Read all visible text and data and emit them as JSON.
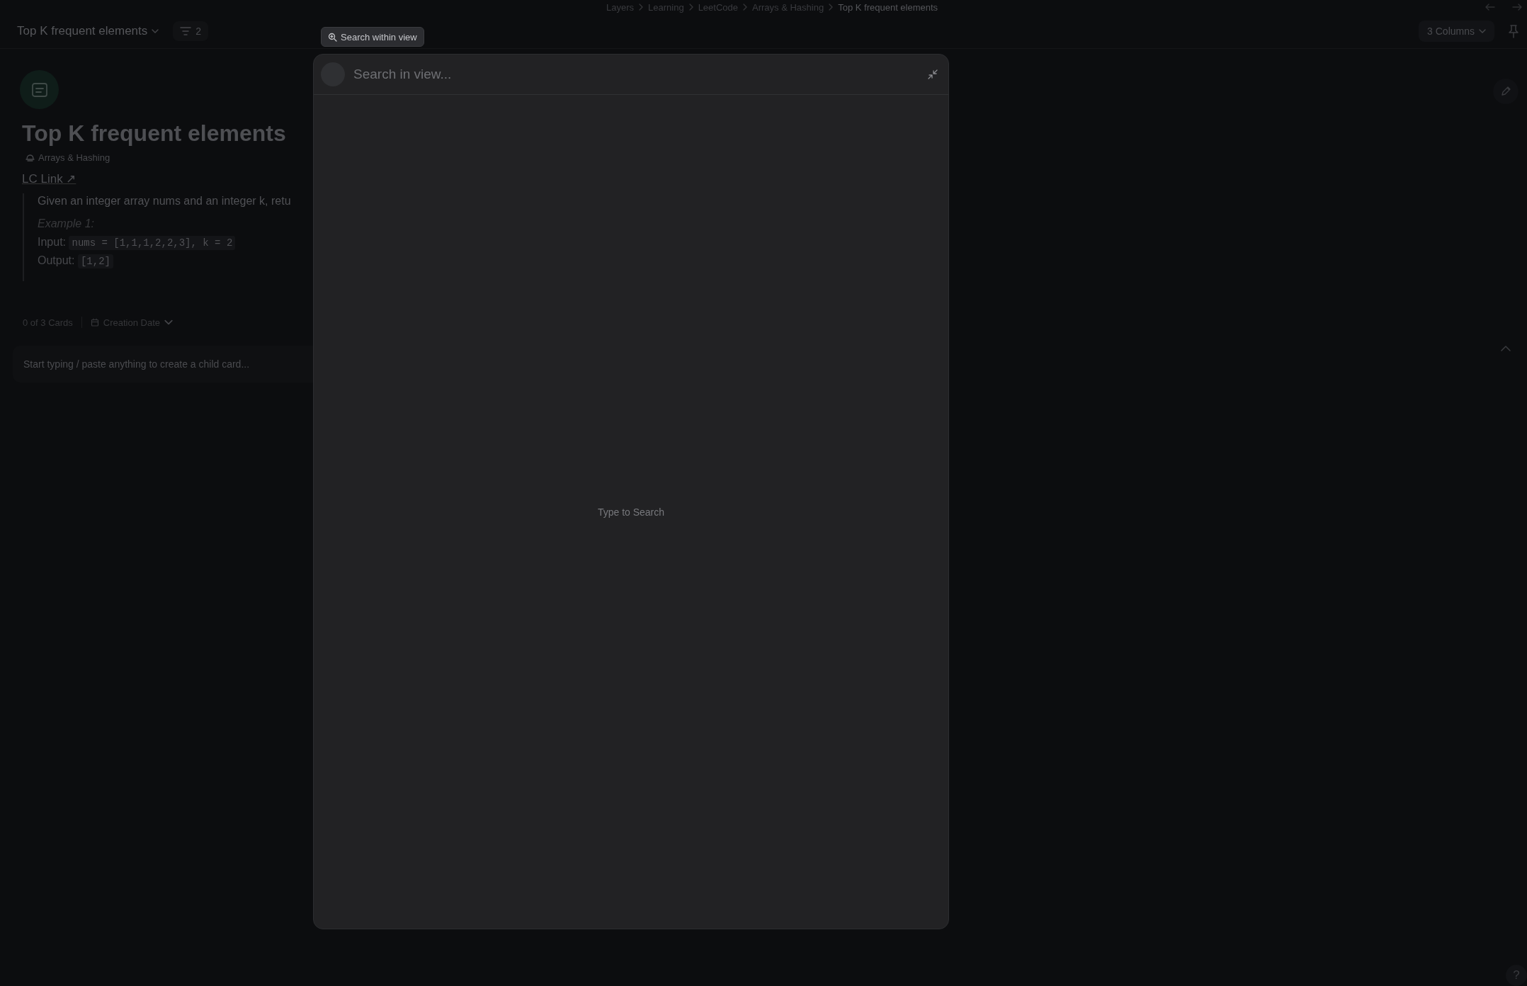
{
  "breadcrumb": [
    {
      "label": "Layers",
      "selected": false
    },
    {
      "label": "Learning",
      "selected": false
    },
    {
      "label": "LeetCode",
      "selected": false
    },
    {
      "label": "Arrays & Hashing",
      "selected": false
    },
    {
      "label": "Top K frequent elements",
      "selected": true
    }
  ],
  "toolbar": {
    "title": "Top K frequent elements",
    "filter_count": "2",
    "columns_button": "3 Columns"
  },
  "card": {
    "title": "Top K frequent elements",
    "tag": "Arrays & Hashing",
    "link": "LC Link ↗",
    "intro": "Given an integer array nums and an integer k, retu",
    "example_heading": "Example 1:",
    "example_lines": [
      {
        "label": "Input:",
        "code": "nums = [1,1,1,2,2,3], k = 2"
      },
      {
        "label": "Output:",
        "code": "[1,2]"
      }
    ]
  },
  "children": {
    "count": "0 of 3 Cards",
    "sort": "Creation Date",
    "placeholder": "Start typing / paste anything to create a child card..."
  },
  "tooltip": "Search within view",
  "search_modal": {
    "placeholder": "Search in view...",
    "empty_text": "Type to Search"
  },
  "help": "?"
}
